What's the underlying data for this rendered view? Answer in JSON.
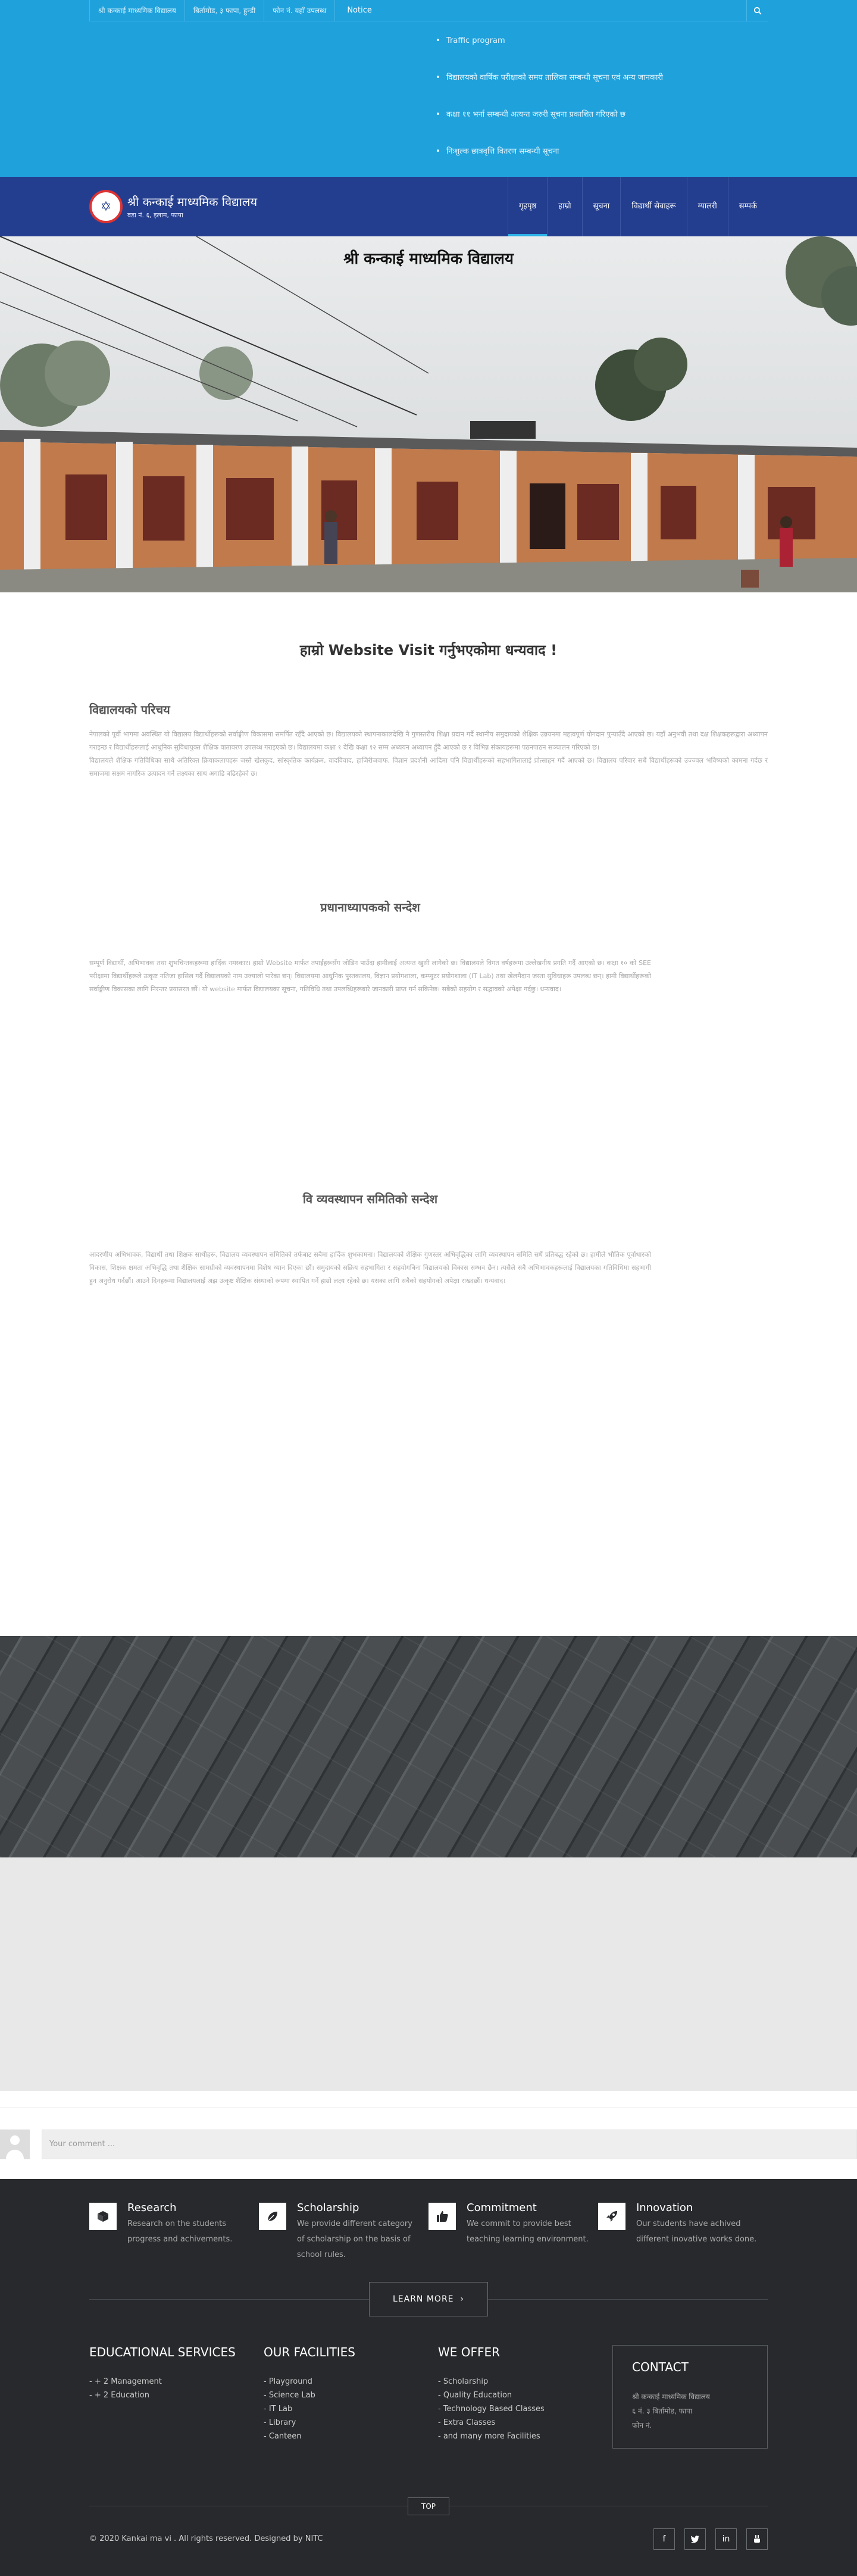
{
  "topbar": {
    "items": [
      "श्री कन्काई माध्यमिक विद्यालय",
      "बिर्तामोड, ३ फापा, हुन्डी",
      "फोन नं. यहाँ उपलब्ध"
    ],
    "notice_label": "Notice",
    "search_icon": "search-icon",
    "notices": [
      "Traffic program",
      "विद्यालयको वार्षिक परीक्षाको समय तालिका सम्बन्धी सूचना एवं अन्य जानकारी",
      "कक्षा ११ भर्ना सम्बन्धी अत्यन्त जरुरी सूचना प्रकाशित गरिएको छ",
      "निःशुल्क छात्रवृत्ति वितरण सम्बन्धी सूचना"
    ]
  },
  "nav": {
    "logo_title": "श्री कन्काई माध्यमिक विद्यालय",
    "logo_sub": "वडा नं. ६, इलाम, फापा",
    "menu": [
      "गृहपृष्ठ",
      "हाम्रो",
      "सूचना",
      "विद्यार्थी सेवाहरू",
      "ग्यालरी",
      "सम्पर्क"
    ],
    "active_index": 0
  },
  "hero": {
    "title": "श्री कन्काई माध्यमिक विद्यालय"
  },
  "welcome": "हाम्रो Website Visit गर्नुभएकोमा धन्यवाद !",
  "intro": {
    "title": "विद्यालयको परिचय",
    "p1": "नेपालको पूर्वी भागमा अवस्थित यो विद्यालय विद्यार्थीहरूको सर्वाङ्गीण विकासमा समर्पित रहँदै आएको छ। विद्यालयको स्थापनाकालदेखि नै गुणस्तरीय शिक्षा प्रदान गर्दै स्थानीय समुदायको शैक्षिक उन्नयनमा महत्वपूर्ण योगदान पुर्‍याउँदै आएको छ। यहाँ अनुभवी तथा दक्ष शिक्षकहरूद्वारा अध्यापन गराइन्छ र विद्यार्थीहरूलाई आधुनिक सुविधायुक्त शैक्षिक वातावरण उपलब्ध गराइएको छ। विद्यालयमा कक्षा १ देखि कक्षा १२ सम्म अध्ययन अध्यापन हुँदै आएको छ र विभिन्न संकायहरूमा पठनपाठन सञ्चालन गरिएको छ।",
    "p2": "विद्यालयले शैक्षिक गतिविधिका साथै अतिरिक्त क्रियाकलापहरू जस्तै खेलकुद, सांस्कृतिक कार्यक्रम, वादविवाद, हाजिरीजवाफ, विज्ञान प्रदर्शनी आदिमा पनि विद्यार्थीहरूको सहभागितालाई प्रोत्साहन गर्दै आएको छ। विद्यालय परिवार सधैं विद्यार्थीहरूको उज्ज्वल भविष्यको कामना गर्दछ र समाजमा सक्षम नागरिक उत्पादन गर्ने लक्ष्यका साथ अगाडि बढिरहेको छ।"
  },
  "principal": {
    "title": "प्रधानाध्यापकको सन्देश",
    "text": "सम्पूर्ण विद्यार्थी, अभिभावक तथा शुभचिन्तकहरूमा हार्दिक नमस्कार। हाम्रो Website मार्फत तपाईंहरूसँग जोडिन पाउँदा हामीलाई अत्यन्त खुसी लागेको छ। विद्यालयले विगत वर्षहरूमा उल्लेखनीय प्रगति गर्दै आएको छ। कक्षा १० को SEE परीक्षामा विद्यार्थीहरूले उत्कृष्ट नतिजा हासिल गर्दै विद्यालयको नाम उज्यालो पारेका छन्। विद्यालयमा आधुनिक पुस्तकालय, विज्ञान प्रयोगशाला, कम्प्युटर प्रयोगशाला (IT Lab) तथा खेलमैदान जस्ता सुविधाहरू उपलब्ध छन्। हामी विद्यार्थीहरूको सर्वाङ्गीण विकासका लागि निरन्तर प्रयासरत छौं। यो website मार्फत विद्यालयका सूचना, गतिविधि तथा उपलब्धिहरूबारे जानकारी प्राप्त गर्न सकिनेछ। सबैको सहयोग र सद्भावको अपेक्षा गर्दछु। धन्यवाद।"
  },
  "chair": {
    "title": "वि व्यवस्थापन समितिको सन्देश",
    "text": "आदरणीय अभिभावक, विद्यार्थी तथा शिक्षक साथीहरू, विद्यालय व्यवस्थापन समितिको तर्फबाट सबैमा हार्दिक शुभकामना। विद्यालयको शैक्षिक गुणस्तर अभिवृद्धिका लागि व्यवस्थापन समिति सधैं प्रतिबद्ध रहेको छ। हामीले भौतिक पूर्वाधारको विकास, शिक्षक क्षमता अभिवृद्धि तथा शैक्षिक सामग्रीको व्यवस्थापनमा विशेष ध्यान दिएका छौं। समुदायको सक्रिय सहभागिता र सहयोगबिना विद्यालयको विकास सम्भव छैन। त्यसैले सबै अभिभावकहरूलाई विद्यालयका गतिविधिमा सहभागी हुन अनुरोध गर्दछौं। आउने दिनहरूमा विद्यालयलाई अझ उत्कृष्ट शैक्षिक संस्थाको रूपमा स्थापित गर्ने हाम्रो लक्ष्य रहेको छ। यसका लागि सबैको सहयोगको अपेक्षा राख्दछौं। धन्यवाद।"
  },
  "comment": {
    "placeholder": "Your comment ..."
  },
  "footer": {
    "features": [
      {
        "icon": "cube-icon",
        "title": "Research",
        "desc": "Research on the students progress and achivements."
      },
      {
        "icon": "leaf-icon",
        "title": "Scholarship",
        "desc": "We provide different category of scholarship on the basis of school rules."
      },
      {
        "icon": "thumbs-up-icon",
        "title": "Commitment",
        "desc": "We commit to provide best teaching learning environment."
      },
      {
        "icon": "rocket-icon",
        "title": "Innovation",
        "desc": "Our students have achived different inovative works done."
      }
    ],
    "learn_more": "LEARN MORE",
    "columns": [
      {
        "title": "EDUCATIONAL SERVICES",
        "items": [
          "+ 2 Management",
          "+ 2 Education"
        ]
      },
      {
        "title": "OUR FACILITIES",
        "items": [
          "Playground",
          "Science Lab",
          "IT Lab",
          "Library",
          "Canteen"
        ]
      },
      {
        "title": "WE OFFER",
        "items": [
          "Scholarship",
          "Quality Education",
          "Technology Based Classes",
          "Extra Classes",
          "and many more Facilities"
        ]
      }
    ],
    "contact": {
      "title": "CONTACT",
      "lines": [
        "श्री कन्काई माध्यमिक विद्यालय",
        "६ नं. ३ बिर्तामोड, फापा",
        "फोन नं."
      ]
    },
    "top": "TOP",
    "copyright": "© 2020 Kankai ma vi . All rights reserved. Designed by NITC",
    "socials": [
      "facebook-icon",
      "twitter-icon",
      "linkedin-icon",
      "youtube-icon"
    ]
  }
}
